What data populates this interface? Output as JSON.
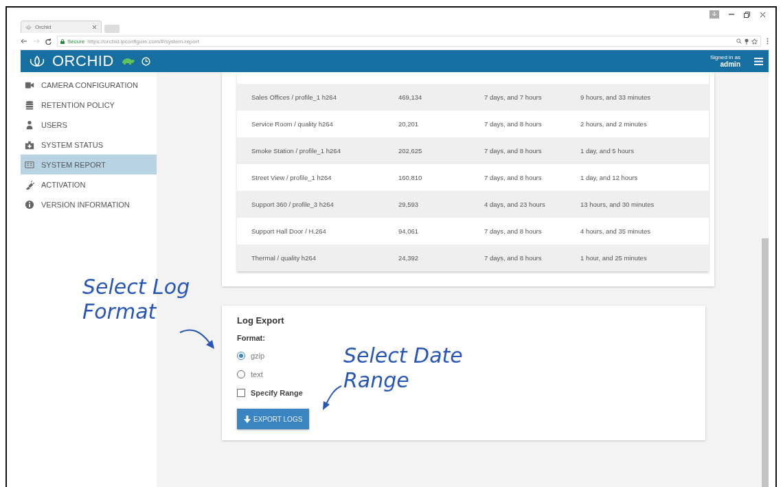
{
  "browser": {
    "tab_title": "Orchid",
    "secure_label": "Secure",
    "url": "https://orchid.ipconfigure.com/#/system-report"
  },
  "header": {
    "logo": "ORCHID",
    "signed_in_label": "Signed in as",
    "user": "admin"
  },
  "sidebar": {
    "items": [
      {
        "label": "CAMERA CONFIGURATION",
        "kind": "camera",
        "selected": false
      },
      {
        "label": "RETENTION POLICY",
        "kind": "database",
        "selected": false
      },
      {
        "label": "USERS",
        "kind": "user",
        "selected": false
      },
      {
        "label": "SYSTEM STATUS",
        "kind": "medkit",
        "selected": false
      },
      {
        "label": "SYSTEM REPORT",
        "kind": "report",
        "selected": true
      },
      {
        "label": "ACTIVATION",
        "kind": "plug",
        "selected": false
      },
      {
        "label": "VERSION INFORMATION",
        "kind": "info",
        "selected": false
      }
    ]
  },
  "table": {
    "rows": [
      [
        "Sales Offices / profile_1 h264",
        "469,134",
        "7 days, and 7 hours",
        "9 hours, and 33 minutes"
      ],
      [
        "Service Room / quality h264",
        "20,201",
        "7 days, and 8 hours",
        "2 hours, and 2 minutes"
      ],
      [
        "Smoke Station / profile_1 h264",
        "202,625",
        "7 days, and 8 hours",
        "1 day, and 5 hours"
      ],
      [
        "Street View / profile_1 h264",
        "160,810",
        "7 days, and 8 hours",
        "1 day, and 12 hours"
      ],
      [
        "Support 360 / profile_3 h264",
        "29,593",
        "4 days, and 23 hours",
        "13 hours, and 30 minutes"
      ],
      [
        "Support Hall Door / H.264",
        "94,061",
        "7 days, and 8 hours",
        "4 hours, and 35 minutes"
      ],
      [
        "Thermal / quality h264",
        "24,392",
        "7 days, and 8 hours",
        "1 hour, and 25 minutes"
      ]
    ]
  },
  "log_export": {
    "title": "Log Export",
    "format_label": "Format:",
    "formats": [
      {
        "label": "gzip",
        "selected": true
      },
      {
        "label": "text",
        "selected": false
      }
    ],
    "specify_range": {
      "label": "Specify Range",
      "checked": false
    },
    "button": "EXPORT LOGS"
  },
  "annotations": [
    {
      "text": "Select Log Format",
      "kind": "format"
    },
    {
      "text": "Select Date Range",
      "kind": "range"
    }
  ]
}
